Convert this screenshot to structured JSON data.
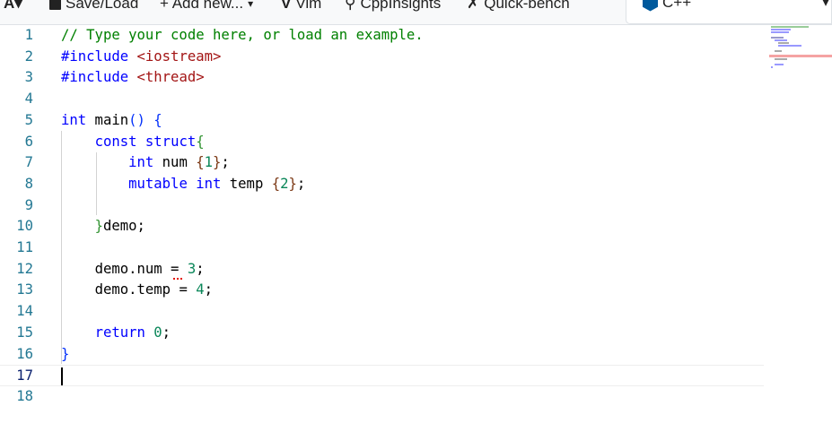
{
  "toolbar": {
    "font_label": "A▾",
    "save_load": "Save/Load",
    "add_new": "+ Add new...",
    "add_new_caret": "▾",
    "vim": "Vim",
    "cppinsights": "CppInsights",
    "quick_bench": "Quick-bench",
    "language": "C++",
    "language_caret": "▾"
  },
  "editor": {
    "current_line": 17,
    "lines": [
      {
        "n": "1"
      },
      {
        "n": "2"
      },
      {
        "n": "3"
      },
      {
        "n": "4"
      },
      {
        "n": "5"
      },
      {
        "n": "6"
      },
      {
        "n": "7"
      },
      {
        "n": "8"
      },
      {
        "n": "9"
      },
      {
        "n": "10"
      },
      {
        "n": "11"
      },
      {
        "n": "12"
      },
      {
        "n": "13"
      },
      {
        "n": "14"
      },
      {
        "n": "15"
      },
      {
        "n": "16"
      },
      {
        "n": "17"
      },
      {
        "n": "18"
      }
    ],
    "tokens": {
      "l1": "// Type your code here, or load an example.",
      "l2a": "#include",
      "l2b": "<iostream>",
      "l3a": "#include",
      "l3b": "<thread>",
      "l5a": "int",
      "l5b": " main",
      "l5c": "()",
      "l5d": " {",
      "l6a": "const",
      "l6b": " struct",
      "l6c": "{",
      "l7a": "int",
      "l7b": " num ",
      "l7c": "{",
      "l7d": "1",
      "l7e": "}",
      "l7f": ";",
      "l8a": "mutable",
      "l8b": " int",
      "l8c": " temp ",
      "l8d": "{",
      "l8e": "2",
      "l8f": "}",
      "l8g": ";",
      "l10a": "}",
      "l10b": "demo;",
      "l12a": "demo.num = ",
      "l12b": "3",
      "l12c": ";",
      "l13a": "demo.temp = ",
      "l13b": "4",
      "l13c": ";",
      "l15a": "return ",
      "l15b": "0",
      "l15c": ";",
      "l16": "}"
    }
  }
}
